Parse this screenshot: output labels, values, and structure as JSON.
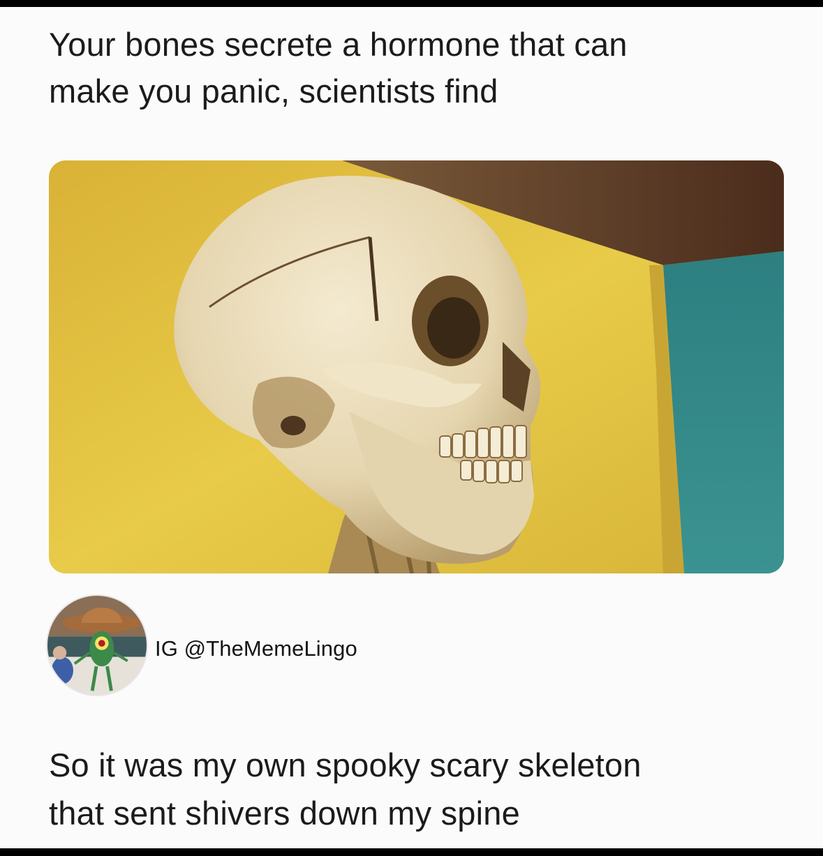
{
  "post": {
    "headline_lines": [
      "Your bones secrete a hormone that can",
      "make you panic, scientists find"
    ],
    "image_description_icon": "skull-photo",
    "avatar_icon": "plankton-cowboy-avatar",
    "handle": "IG @TheMemeLingo",
    "reply_lines": [
      "So it was my own spooky scary skeleton",
      "that sent shivers down my spine"
    ]
  },
  "colors": {
    "page_background": "#fbfbfb",
    "border": "#000000",
    "text": "#1b1b1b",
    "photo_wall_yellow": "#e2c13e",
    "photo_ceiling": "#5a3a26",
    "photo_teal": "#2f8a8a",
    "bone": "#ece0c2"
  }
}
